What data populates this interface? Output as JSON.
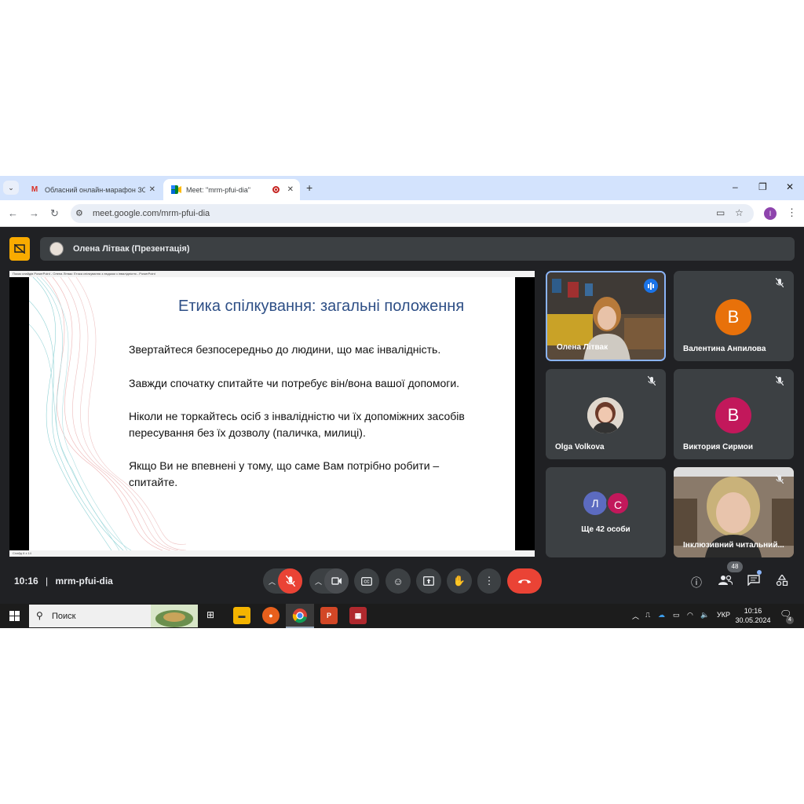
{
  "browser": {
    "tabs": [
      {
        "label": "Обласний онлайн-марафон ЗО",
        "favicon": "gmail-icon"
      },
      {
        "label": "Meet: \"mrm-pfui-dia\"",
        "favicon": "google-meet-icon"
      }
    ],
    "url": "meet.google.com/mrm-pfui-dia",
    "profile_initial": "I"
  },
  "meet": {
    "presenter_label": "Олена Літвак (Презентація)",
    "time": "10:16",
    "separator": "|",
    "meeting_code": "mrm-pfui-dia",
    "participants_count": "48"
  },
  "powerpoint": {
    "title_bar": "Показ слайдів PowerPoint - Олена Літвак: Етика спілкування з людьми з інвалідністю - PowerPoint",
    "status": "Слайд 6 з 14"
  },
  "slide": {
    "title": "Етика спілкування: загальні положення",
    "lines": [
      "Звертайтеся безпосередньо до людини, що має інвалідність.",
      "Завжди спочатку спитайте чи  потребує  він/вона вашої допомоги.",
      " Ніколи не торкайтесь осіб з інвалідністю чи їх допоміжних засобів",
      "пересування без їх дозволу (паличка, милиці).",
      "Якщо Ви не впевнені у тому, що саме Вам потрібно робити –",
      "спитайте."
    ]
  },
  "participants": [
    {
      "name": "Олена Літвак",
      "type": "video"
    },
    {
      "name": "Валентина Анпилова",
      "initial": "В",
      "color": "#e8710a"
    },
    {
      "name": "Olga Volkova",
      "type": "photo"
    },
    {
      "name": "Виктория Сирмои",
      "initial": "В",
      "color": "#c2185b"
    },
    {
      "name": "Ще 42 особи",
      "initials": [
        "Л",
        "С"
      ],
      "colors": [
        "#5c6bc0",
        "#c2185b"
      ]
    },
    {
      "name": "Інклюзивний читальний...",
      "type": "video"
    }
  ],
  "taskbar": {
    "search_placeholder": "Поиск",
    "language": "УКР",
    "time": "10:16",
    "date": "30.05.2024",
    "notifications": "4"
  }
}
